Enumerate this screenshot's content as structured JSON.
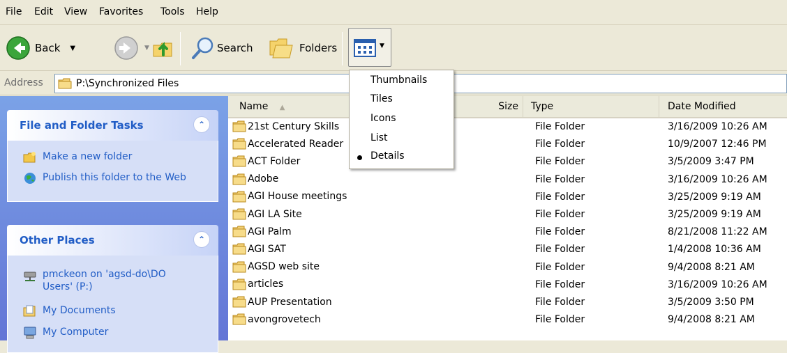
{
  "menu": [
    "File",
    "Edit",
    "View",
    "Favorites",
    "Tools",
    "Help"
  ],
  "toolbar": {
    "back_label": "Back",
    "search_label": "Search",
    "folders_label": "Folders"
  },
  "address": {
    "label": "Address",
    "value": "P:\\Synchronized Files"
  },
  "tasks_panel": {
    "title": "File and Folder Tasks",
    "collapse_glyph": "⌃",
    "items": [
      {
        "label": "Make a new folder",
        "icon": "new-folder-icon"
      },
      {
        "label": "Publish this folder to the Web",
        "icon": "publish-web-icon"
      }
    ]
  },
  "places_panel": {
    "title": "Other Places",
    "collapse_glyph": "⌃",
    "items": [
      {
        "label": "pmckeon on 'agsd-do\\DO Users' (P:)",
        "icon": "network-drive-icon"
      },
      {
        "label": "My Documents",
        "icon": "my-documents-icon"
      },
      {
        "label": "My Computer",
        "icon": "my-computer-icon"
      }
    ]
  },
  "columns": {
    "name": "Name",
    "size": "Size",
    "type": "Type",
    "date": "Date Modified",
    "sort_glyph": "▲"
  },
  "files": [
    {
      "name": "21st Century Skills",
      "type": "File Folder",
      "date": "3/16/2009 10:26 AM"
    },
    {
      "name": "Accelerated Reader",
      "type": "File Folder",
      "date": "10/9/2007 12:46 PM"
    },
    {
      "name": "ACT Folder",
      "type": "File Folder",
      "date": "3/5/2009 3:47 PM"
    },
    {
      "name": "Adobe",
      "type": "File Folder",
      "date": "3/16/2009 10:26 AM"
    },
    {
      "name": "AGI House meetings",
      "type": "File Folder",
      "date": "3/25/2009 9:19 AM"
    },
    {
      "name": "AGI LA Site",
      "type": "File Folder",
      "date": "3/25/2009 9:19 AM"
    },
    {
      "name": "AGI Palm",
      "type": "File Folder",
      "date": "8/21/2008 11:22 AM"
    },
    {
      "name": "AGI SAT",
      "type": "File Folder",
      "date": "1/4/2008 10:36 AM"
    },
    {
      "name": "AGSD web site",
      "type": "File Folder",
      "date": "9/4/2008 8:21 AM"
    },
    {
      "name": "articles",
      "type": "File Folder",
      "date": "3/16/2009 10:26 AM"
    },
    {
      "name": "AUP Presentation",
      "type": "File Folder",
      "date": "3/5/2009 3:50 PM"
    },
    {
      "name": "avongrovetech",
      "type": "File Folder",
      "date": "9/4/2008 8:21 AM"
    }
  ],
  "view_menu": {
    "items": [
      "Thumbnails",
      "Tiles",
      "Icons",
      "List",
      "Details"
    ],
    "selected": "Details"
  },
  "colors": {
    "link_blue": "#215DC6",
    "pane_gradient_top": "#7BA2E7",
    "pane_gradient_bottom": "#6375D6"
  }
}
